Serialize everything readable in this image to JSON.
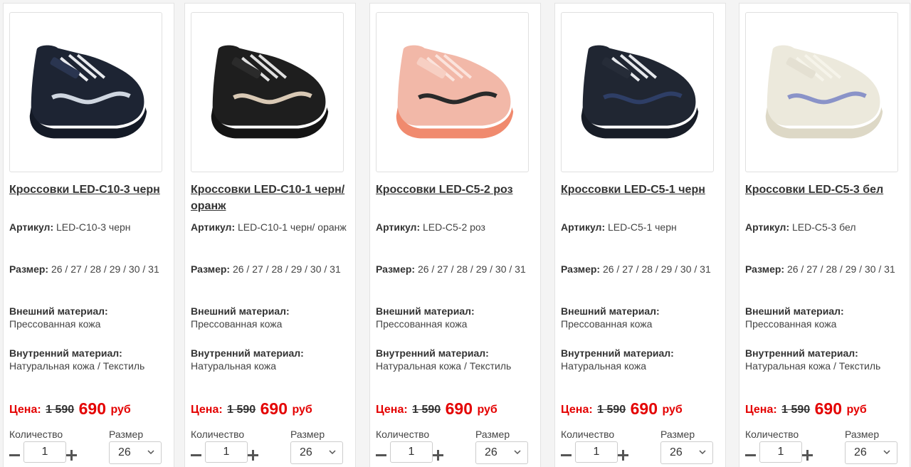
{
  "labels": {
    "article": "Артикул:",
    "size": "Размер:",
    "outer_material": "Внешний материал:",
    "inner_material": "Внутренний материал:",
    "price": "Цена:",
    "currency": "руб",
    "quantity": "Количество",
    "size_select": "Размер"
  },
  "colors": {
    "price_red": "#e40000",
    "text": "#333333",
    "border": "#e3e3e3"
  },
  "products": [
    {
      "title": "Кроссовки LED-C10-3 черн",
      "article": "LED-C10-3 черн",
      "sizes": "26 / 27 / 28 / 29 / 30 / 31",
      "outer_material": "Прессованная кожа",
      "inner_material": "Натуральная кожа / Текстиль",
      "old_price": "1 590",
      "new_price": "690",
      "quantity": "1",
      "selected_size": "26"
    },
    {
      "title": "Кроссовки LED-C10-1 черн/оранж",
      "article": "LED-C10-1 черн/ оранж",
      "sizes": "26 / 27 / 28 / 29 / 30 / 31",
      "outer_material": "Прессованная кожа",
      "inner_material": "Натуральная кожа",
      "old_price": "1 590",
      "new_price": "690",
      "quantity": "1",
      "selected_size": "26"
    },
    {
      "title": "Кроссовки LED-C5-2 роз",
      "article": "LED-C5-2 роз",
      "sizes": "26 / 27 / 28 / 29 / 30 / 31",
      "outer_material": "Прессованная кожа",
      "inner_material": "Натуральная кожа / Текстиль",
      "old_price": "1 590",
      "new_price": "690",
      "quantity": "1",
      "selected_size": "26"
    },
    {
      "title": "Кроссовки LED-C5-1 черн",
      "article": "LED-C5-1 черн",
      "sizes": "26 / 27 / 28 / 29 / 30 / 31",
      "outer_material": "Прессованная кожа",
      "inner_material": "Натуральная кожа",
      "old_price": "1 590",
      "new_price": "690",
      "quantity": "1",
      "selected_size": "26"
    },
    {
      "title": "Кроссовки LED-C5-3 бел",
      "article": "LED-C5-3 бел",
      "sizes": "26 / 27 / 28 / 29 / 30 / 31",
      "outer_material": "Прессованная кожа",
      "inner_material": "Натуральная кожа / Текстиль",
      "old_price": "1 590",
      "new_price": "690",
      "quantity": "1",
      "selected_size": "26"
    }
  ]
}
